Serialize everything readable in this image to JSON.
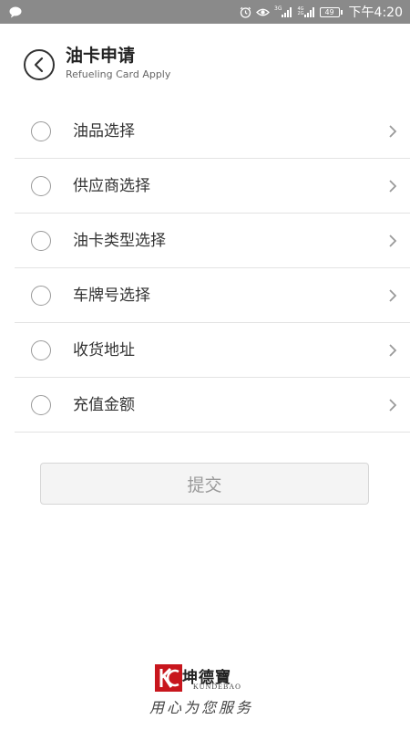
{
  "status_bar": {
    "network_3g": "3G",
    "network_4g": "4G",
    "network_2g": "2G",
    "battery": "49",
    "time": "下午4:20"
  },
  "header": {
    "title": "油卡申请",
    "subtitle": "Refueling Card Apply"
  },
  "options": [
    {
      "label": "油品选择"
    },
    {
      "label": "供应商选择"
    },
    {
      "label": "油卡类型选择"
    },
    {
      "label": "车牌号选择"
    },
    {
      "label": "收货地址"
    },
    {
      "label": "充值金额"
    }
  ],
  "submit_label": "提交",
  "footer": {
    "brand_name": "坤德寶",
    "brand_en": "KUNDEBAO",
    "slogan": "用心为您服务"
  },
  "colors": {
    "status_bar_bg": "#8a8a8a",
    "submit_bg": "#f4f4f4",
    "logo_red": "#c8161d"
  },
  "icons": {
    "back": "chevron-left-circle-icon",
    "row_arrow": "chevron-right-icon",
    "message": "message-bubble-icon",
    "alarm": "alarm-icon",
    "eye": "eye-icon"
  }
}
